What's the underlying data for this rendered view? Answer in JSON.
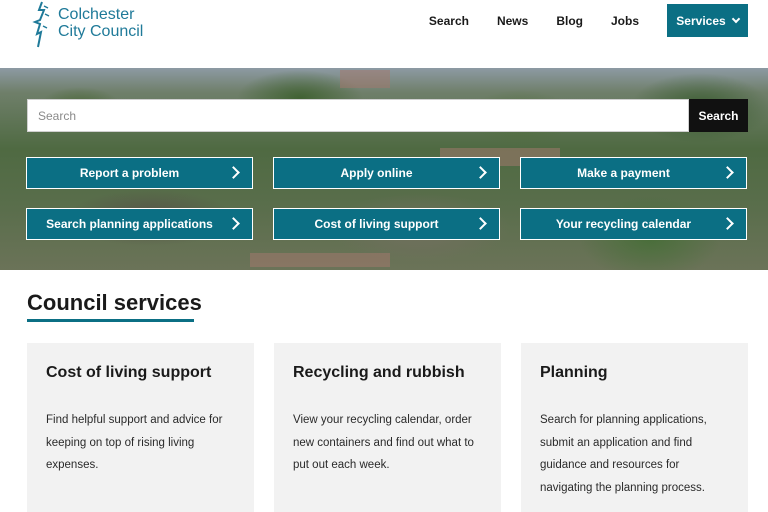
{
  "header": {
    "logo_line1": "Colchester",
    "logo_line2": "City Council",
    "nav": [
      "Search",
      "News",
      "Blog",
      "Jobs"
    ],
    "services_label": "Services",
    "brand_color": "#0b6f84"
  },
  "hero": {
    "search_placeholder": "Search",
    "search_button": "Search",
    "quick_links": [
      "Report a problem",
      "Apply online",
      "Make a payment",
      "Search planning applications",
      "Cost of living support",
      "Your recycling calendar"
    ]
  },
  "services": {
    "title": "Council services",
    "cards": [
      {
        "title": "Cost of living support",
        "text": "Find helpful support and advice for keeping on top of rising living expenses."
      },
      {
        "title": "Recycling and rubbish",
        "text": "View your recycling calendar, order new containers and find out what to put out each week."
      },
      {
        "title": "Planning",
        "text": "Search for planning applications, submit an application and find guidance and resources for navigating the planning process."
      }
    ]
  }
}
